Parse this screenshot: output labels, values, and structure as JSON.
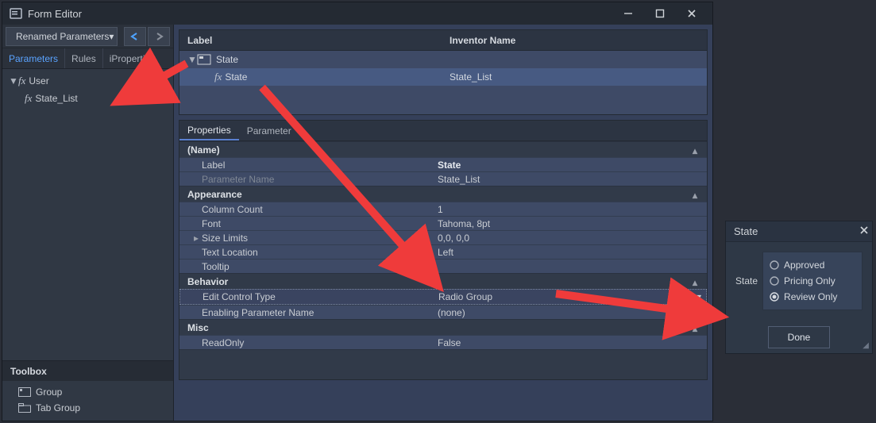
{
  "window": {
    "title": "Form Editor"
  },
  "sidebar": {
    "filter_label": "Renamed Parameters",
    "tabs": {
      "parameters": "Parameters",
      "rules": "Rules",
      "iproperties": "iProperties"
    },
    "tree": {
      "group": "User",
      "item": "State_List"
    },
    "toolbox": {
      "header": "Toolbox",
      "items": [
        "Group",
        "Tab Group"
      ]
    }
  },
  "form_grid": {
    "headers": {
      "label": "Label",
      "inventor": "Inventor Name"
    },
    "group": "State",
    "row": {
      "label": "State",
      "inventor": "State_List"
    }
  },
  "properties": {
    "tabs": {
      "properties": "Properties",
      "parameter": "Parameter"
    },
    "name_cat": "(Name)",
    "label_k": "Label",
    "label_v": "State",
    "paramname_k": "Parameter Name",
    "paramname_v": "State_List",
    "appearance_cat": "Appearance",
    "colcount_k": "Column Count",
    "colcount_v": "1",
    "font_k": "Font",
    "font_v": "Tahoma, 8pt",
    "sizelimits_k": "Size Limits",
    "sizelimits_v": "0,0, 0,0",
    "textloc_k": "Text Location",
    "textloc_v": "Left",
    "tooltip_k": "Tooltip",
    "tooltip_v": "",
    "behavior_cat": "Behavior",
    "editctrl_k": "Edit Control Type",
    "editctrl_v": "Radio Group",
    "enparam_k": "Enabling Parameter Name",
    "enparam_v": "(none)",
    "misc_cat": "Misc",
    "readonly_k": "ReadOnly",
    "readonly_v": "False"
  },
  "panel": {
    "title": "State",
    "label": "State",
    "options": [
      "Approved",
      "Pricing Only",
      "Review Only"
    ],
    "selected_index": 2,
    "done": "Done"
  }
}
